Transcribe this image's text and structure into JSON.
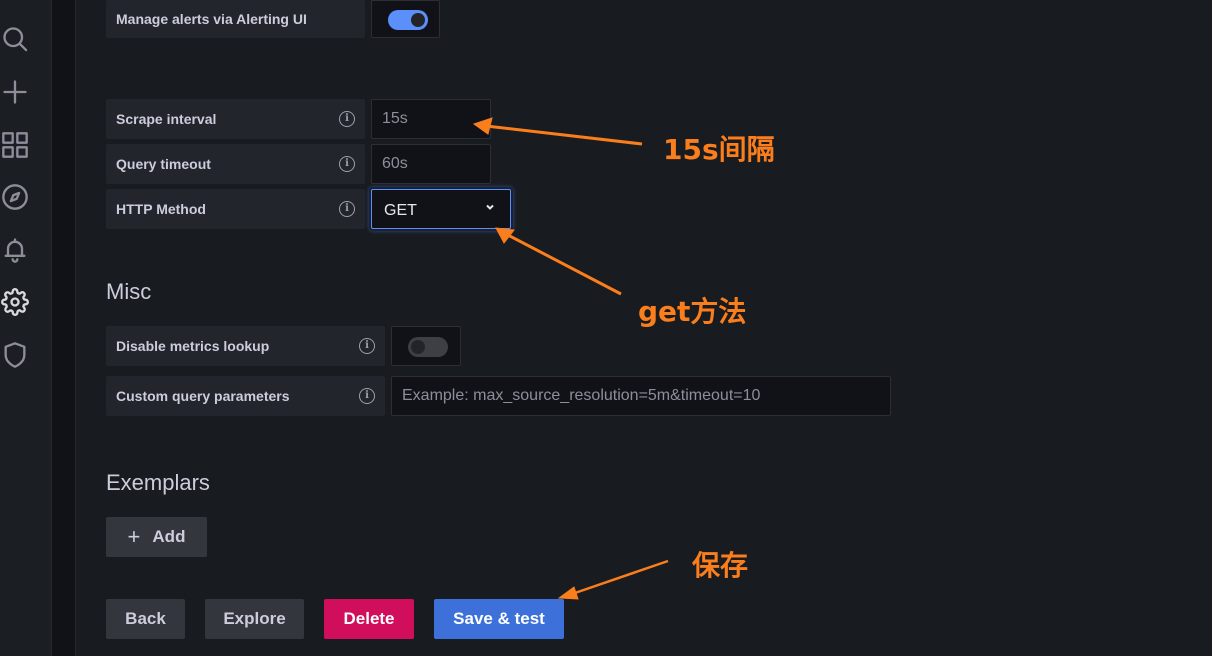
{
  "sidebar": {
    "icons": [
      {
        "name": "search-icon"
      },
      {
        "name": "plus-icon"
      },
      {
        "name": "dashboards-icon"
      },
      {
        "name": "explore-compass-icon"
      },
      {
        "name": "alerting-bell-icon"
      },
      {
        "name": "configuration-gear-icon"
      },
      {
        "name": "server-admin-shield-icon"
      }
    ]
  },
  "alerting": {
    "manage_alerts_label": "Manage alerts via Alerting UI",
    "manage_alerts_enabled": true
  },
  "interval_behaviour": {
    "scrape_interval": {
      "label": "Scrape interval",
      "info_icon": "i",
      "placeholder": "15s",
      "value": ""
    },
    "query_timeout": {
      "label": "Query timeout",
      "info_icon": "i",
      "placeholder": "60s",
      "value": ""
    },
    "http_method": {
      "label": "HTTP Method",
      "info_icon": "i",
      "value": "GET"
    }
  },
  "misc": {
    "title": "Misc",
    "disable_metrics_lookup": {
      "label": "Disable metrics lookup",
      "info_icon": "i",
      "enabled": false
    },
    "custom_query_parameters": {
      "label": "Custom query parameters",
      "info_icon": "i",
      "placeholder": "Example: max_source_resolution=5m&timeout=10",
      "value": ""
    }
  },
  "exemplars": {
    "title": "Exemplars",
    "add_label": "Add",
    "add_icon": "+"
  },
  "actions": {
    "back": "Back",
    "explore": "Explore",
    "delete": "Delete",
    "save_test": "Save & test"
  },
  "annotations": {
    "scrape_note": "15s间隔",
    "method_note": "get方法",
    "save_note": "保存",
    "color": "#fb7e1c"
  },
  "colors": {
    "primary": "#3d71d9",
    "destructive": "#d10e5c",
    "toggle_on": "#5b8ff9",
    "background": "#181b1f"
  }
}
